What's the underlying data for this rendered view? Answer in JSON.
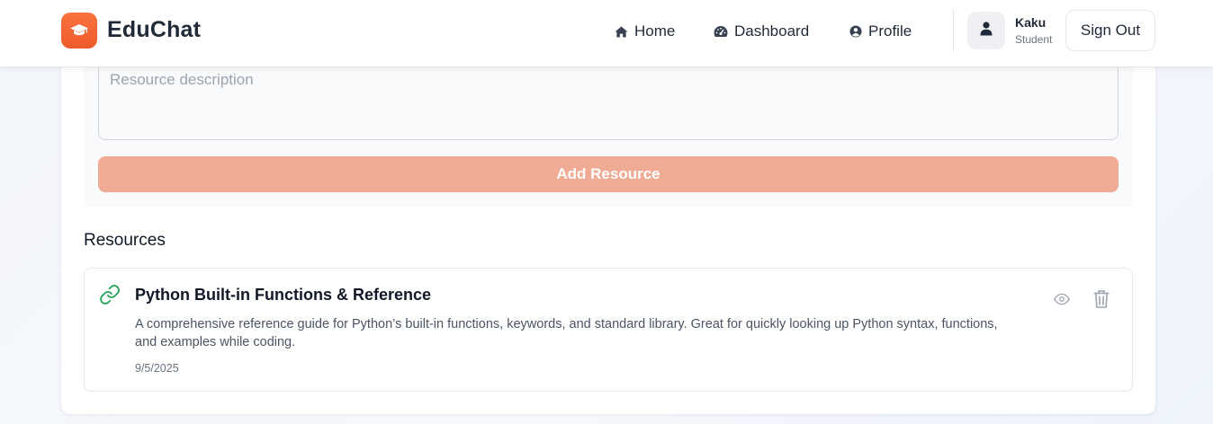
{
  "app": {
    "brand": "EduChat",
    "logo_icon": "graduation-cap-icon",
    "accent_color": "#f26b35"
  },
  "nav": {
    "items": [
      {
        "label": "Home",
        "icon": "home-icon"
      },
      {
        "label": "Dashboard",
        "icon": "dashboard-gauge-icon"
      },
      {
        "label": "Profile",
        "icon": "user-circle-icon"
      }
    ]
  },
  "user": {
    "name": "Kaku",
    "role": "Student",
    "avatar_icon": "user-icon",
    "signout_label": "Sign Out"
  },
  "form": {
    "description_placeholder": "Resource description",
    "description_value": "",
    "add_button_label": "Add Resource",
    "add_button_color": "#f0ab95"
  },
  "resources": {
    "heading": "Resources",
    "items": [
      {
        "type_icon": "link-icon",
        "title": "Python Built-in Functions & Reference",
        "description": "A comprehensive reference guide for Python’s built-in functions, keywords, and standard library. Great for quickly looking up Python syntax, functions, and examples while coding.",
        "date": "9/5/2025",
        "actions": [
          "eye-icon",
          "trash-icon"
        ]
      }
    ]
  }
}
